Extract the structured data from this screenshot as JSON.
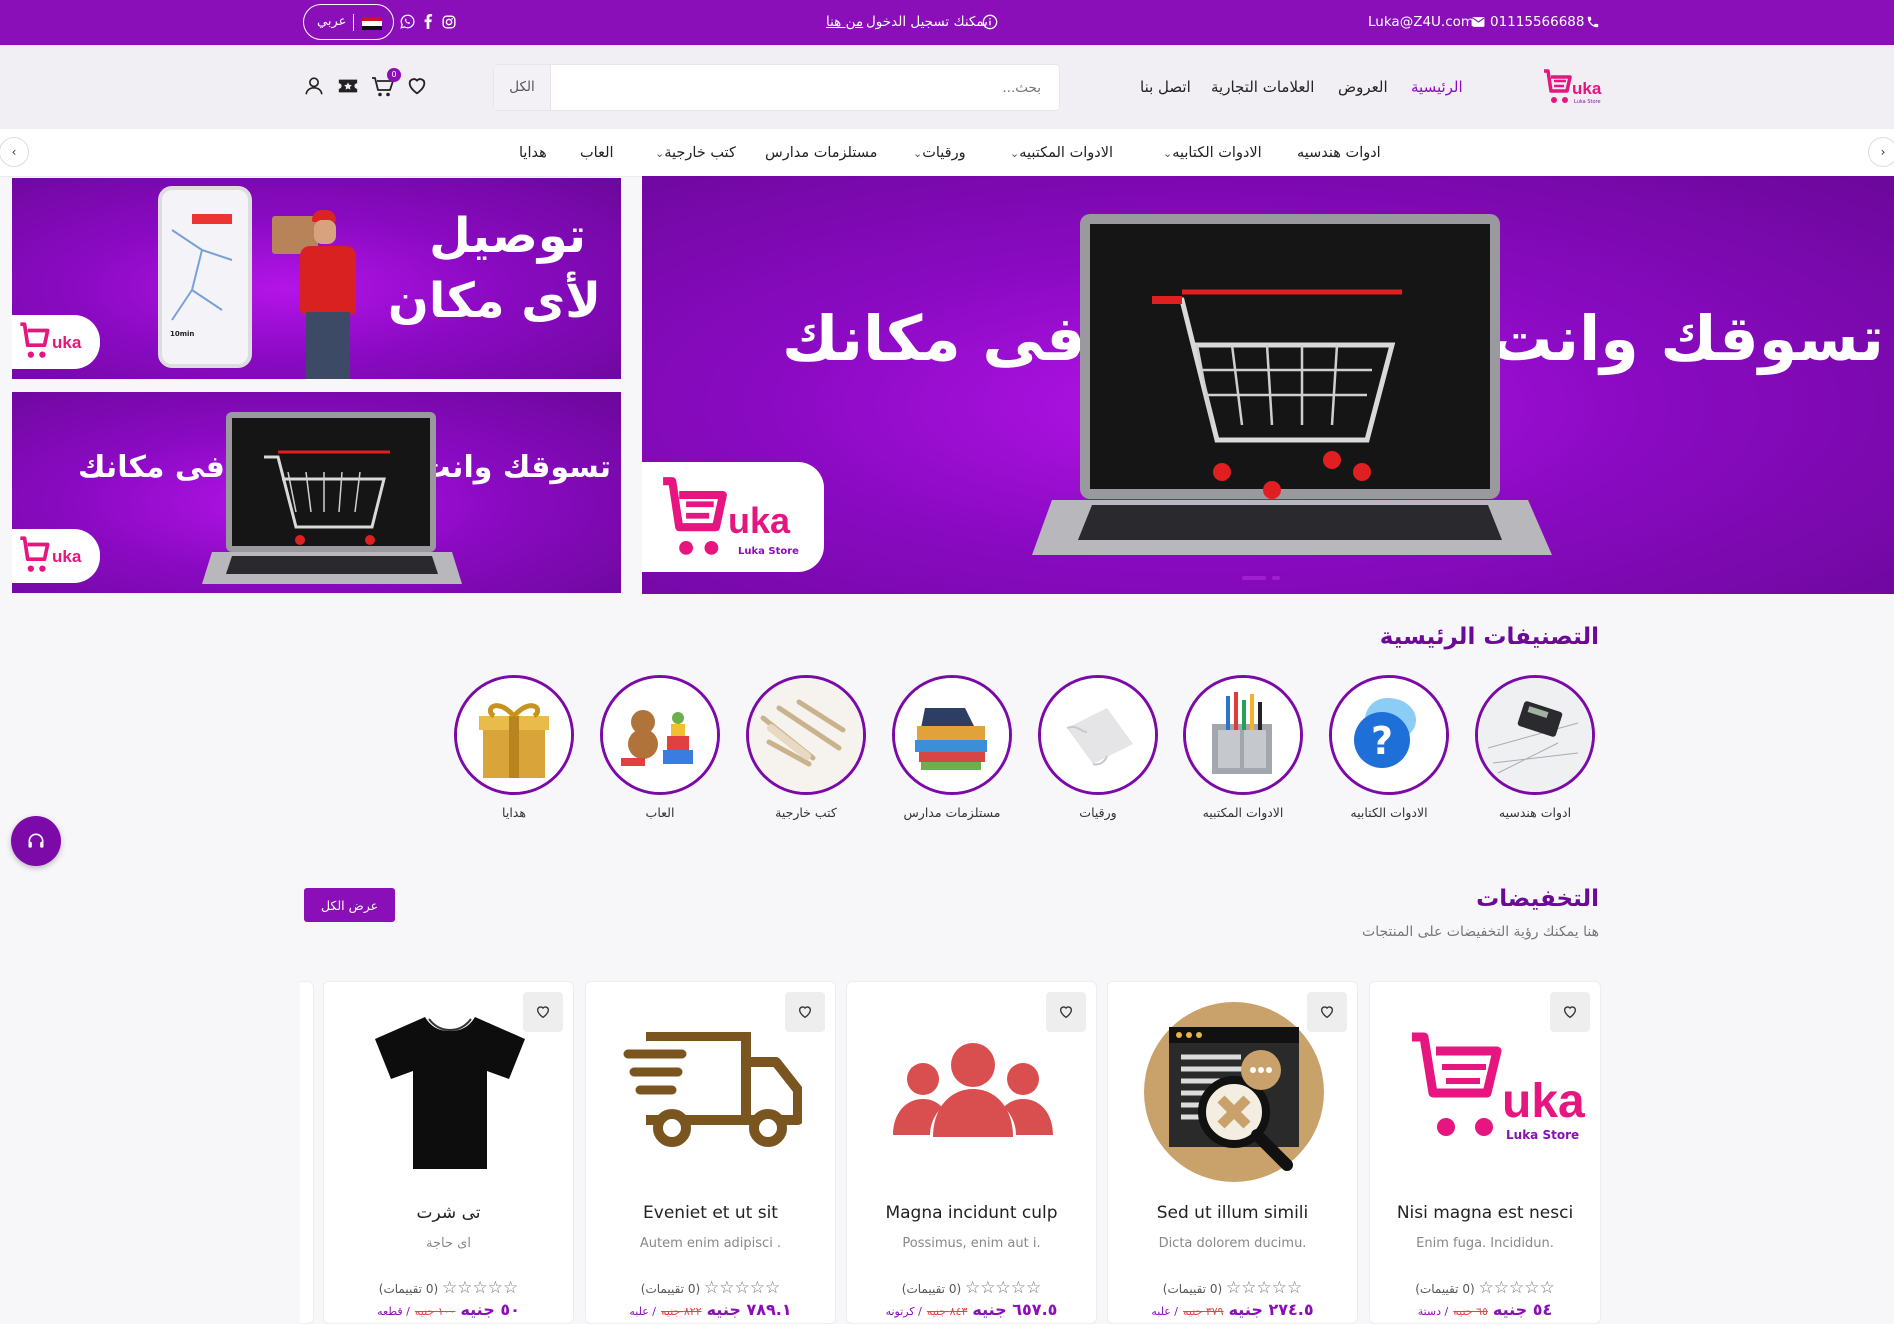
{
  "colors": {
    "brand": "#8a0fb8",
    "accent_pink": "#e6157f",
    "price": "#8a0fb8",
    "old_price": "#e04545"
  },
  "topbar": {
    "phone": "01115566688",
    "email": "Luka@Z4U.com",
    "login_prompt": "يمكنك تسجيل الدخول",
    "login_link": "من هنا",
    "lang_label": "عربي",
    "icons": [
      "phone-icon",
      "mail-icon",
      "info-icon",
      "instagram-icon",
      "facebook-icon",
      "whatsapp-icon",
      "egypt-flag-icon"
    ]
  },
  "header": {
    "logo_text": "uka",
    "logo_sub": "Luka Store",
    "nav": [
      "الرئيسية",
      "العروض",
      "العلامات التجارية",
      "اتصل بنا"
    ],
    "search_placeholder": "بحث...",
    "search_category": "الكل",
    "cart_count": "0"
  },
  "categories_bar": [
    {
      "label": "ادوات هندسيه",
      "dropdown": false
    },
    {
      "label": "الادوات الكتابيه",
      "dropdown": true
    },
    {
      "label": "الادوات المكتبيه",
      "dropdown": true
    },
    {
      "label": "ورقيات",
      "dropdown": true
    },
    {
      "label": "مستلزمات مدارس",
      "dropdown": false
    },
    {
      "label": "كتب خارجية",
      "dropdown": true
    },
    {
      "label": "العاب",
      "dropdown": false
    },
    {
      "label": "هدايا",
      "dropdown": false
    }
  ],
  "hero": {
    "main": {
      "line1": "تسوقك وانت",
      "line2": "فى مكانك"
    },
    "side_top": {
      "line1": "توصيل",
      "line2": "لأى مكان",
      "phone_eta": "10min"
    },
    "side_bottom": {
      "line1": "تسوقك وانت",
      "line2": "فى مكانك"
    }
  },
  "main_categories": {
    "title": "التصنيفات الرئيسية",
    "items": [
      {
        "label": "ادوات هندسيه",
        "icon": "calculator-tools-icon"
      },
      {
        "label": "الادوات الكتابيه",
        "icon": "question-bubble-icon"
      },
      {
        "label": "الادوات المكتبيه",
        "icon": "desk-organizer-icon"
      },
      {
        "label": "ورقيات",
        "icon": "paper-icon"
      },
      {
        "label": "مستلزمات مدارس",
        "icon": "school-supplies-icon"
      },
      {
        "label": "كتب خارجية",
        "icon": "pencils-icon"
      },
      {
        "label": "العاب",
        "icon": "toys-icon"
      },
      {
        "label": "هدايا",
        "icon": "gift-box-icon"
      }
    ]
  },
  "discounts": {
    "title": "التخفيضات",
    "subtitle": "هنا يمكنك رؤية التخفيضات على المنتجات",
    "view_all": "عرض الكل",
    "products": [
      {
        "title": "Nisi magna est nesci",
        "desc": "Enim fuga. Incididun.",
        "rating_text": "(0 تقييمات)",
        "price": "٥٤ جنيه",
        "old_price": "٦٥ جنيه",
        "unit": "/ دستة",
        "image": "luka-logo-image"
      },
      {
        "title": "Sed ut illum simili",
        "desc": "Dicta dolorem ducimu.",
        "rating_text": "(0 تقييمات)",
        "price": "٢٧٤.٥ جنيه",
        "old_price": "٣٧٩ جنيه",
        "unit": "/ علبه",
        "image": "search-browser-image"
      },
      {
        "title": "Magna incidunt culp",
        "desc": "Possimus, enim aut i.",
        "rating_text": "(0 تقييمات)",
        "price": "٦٥٧.٥ جنيه",
        "old_price": "٨٤٣ جنيه",
        "unit": "/ كرتونه",
        "image": "users-group-image"
      },
      {
        "title": "Eveniet et ut sit",
        "desc": "Autem enim adipisci .",
        "rating_text": "(0 تقييمات)",
        "price": "٧٨٩.١ جنيه",
        "old_price": "٨٢٢ جنيه",
        "unit": "/ علبه",
        "image": "delivery-truck-image"
      },
      {
        "title": "تى شرت",
        "desc": "اى حاجة",
        "rating_text": "(0 تقييمات)",
        "price": "٥٠ جنيه",
        "old_price": "١٠٠ جنيه",
        "unit": "/ قطعه",
        "image": "tshirt-image"
      }
    ]
  }
}
